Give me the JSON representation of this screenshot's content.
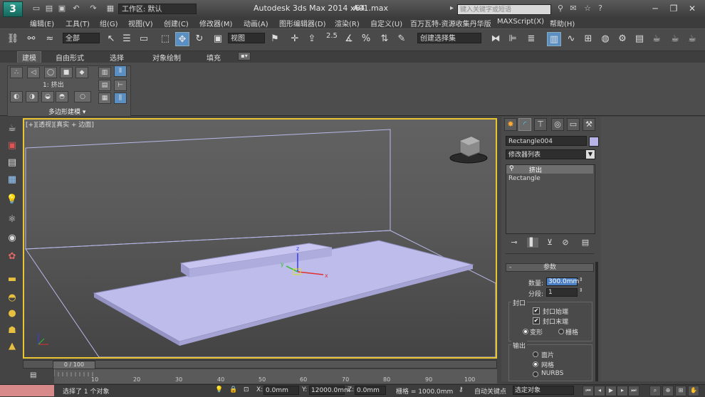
{
  "titlebar": {
    "logo": "3",
    "workspace_label": "工作区: 默认",
    "app_title": "Autodesk 3ds Max  2014 x64",
    "file_name": "A01.max",
    "search_placeholder": "键入关键字或短语"
  },
  "menu": [
    "编辑(E)",
    "工具(T)",
    "组(G)",
    "视图(V)",
    "创建(C)",
    "修改器(M)",
    "动画(A)",
    "图形编辑器(D)",
    "渲染(R)",
    "自定义(U)",
    "百万瓦特-资源收集丹华版",
    "MAXScript(X)",
    "帮助(H)"
  ],
  "toolbar": {
    "selection_filter": "全部",
    "ref_coord": "视图",
    "snap_value": "2.5",
    "named_selection": "创建选择集"
  },
  "ribbon": {
    "tabs": [
      "建模",
      "自由形式",
      "选择",
      "对象绘制",
      "填充"
    ],
    "active_tab": "建模",
    "modifier_label": "1: 挤出",
    "panel_title": "多边形建模"
  },
  "viewport": {
    "label_plus": "[+]",
    "label_view": "[透视]",
    "label_shading": "[真实 + 边面]",
    "gizmo_x": "x",
    "gizmo_y": "y",
    "gizmo_z": "z",
    "border_color": "#e8c531"
  },
  "command_panel": {
    "object_name": "Rectangle004",
    "object_color": "#b7b3e6",
    "modifier_list": "修改器列表",
    "stack": [
      "挤出",
      "Rectangle"
    ],
    "params_title": "参数",
    "amount_label": "数量:",
    "amount_value": "300.0mm",
    "segments_label": "分段:",
    "segments_value": "1",
    "capping_title": "封口",
    "cap_start": "封口始端",
    "cap_end": "封口末端",
    "morph": "变形",
    "grid": "栅格",
    "output_title": "输出",
    "patch": "面片",
    "mesh": "网格",
    "nurbs": "NURBS"
  },
  "timeline": {
    "frame_display": "0 / 100",
    "ticks": [
      "10",
      "20",
      "30",
      "40",
      "50",
      "60",
      "70",
      "80",
      "90",
      "100"
    ]
  },
  "statusbar": {
    "selection_text": "选择了 1 个对象",
    "x_label": "X:",
    "x_value": "0.0mm",
    "y_label": "Y:",
    "y_value": "12000.0mm",
    "z_label": "Z:",
    "z_value": "0.0mm",
    "grid_text": "栅格 = 1000.0mm",
    "auto_key": "自动关键点",
    "key_filter": "选定对象"
  }
}
